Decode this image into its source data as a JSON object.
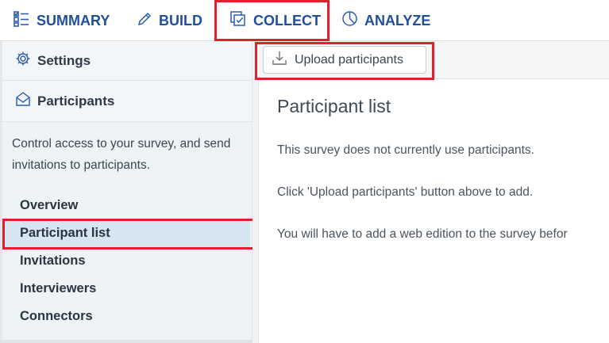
{
  "nav": {
    "tabs": [
      {
        "label": "SUMMARY",
        "icon": "checklist-icon"
      },
      {
        "label": "BUILD",
        "icon": "pencil-icon"
      },
      {
        "label": "COLLECT",
        "icon": "collect-icon"
      },
      {
        "label": "ANALYZE",
        "icon": "pie-chart-icon"
      }
    ],
    "active_tab": "COLLECT"
  },
  "sidebar": {
    "settings_label": "Settings",
    "participants_label": "Participants",
    "description": "Control access to your survey, and send invitations to participants.",
    "items": [
      {
        "label": "Overview"
      },
      {
        "label": "Participant list"
      },
      {
        "label": "Invitations"
      },
      {
        "label": "Interviewers"
      },
      {
        "label": "Connectors"
      }
    ],
    "selected_item": "Participant list"
  },
  "toolbar": {
    "upload_label": "Upload participants"
  },
  "main": {
    "title": "Participant list",
    "messages": [
      "This survey does not currently use participants.",
      "Click 'Upload participants' button above to add.",
      "You will have to add a web edition to the survey befor"
    ]
  },
  "colors": {
    "nav_text": "#1f4e9c",
    "highlight": "#e0202c",
    "selected_bg": "#d6e6f0",
    "panel_bg": "#eef3f6"
  }
}
